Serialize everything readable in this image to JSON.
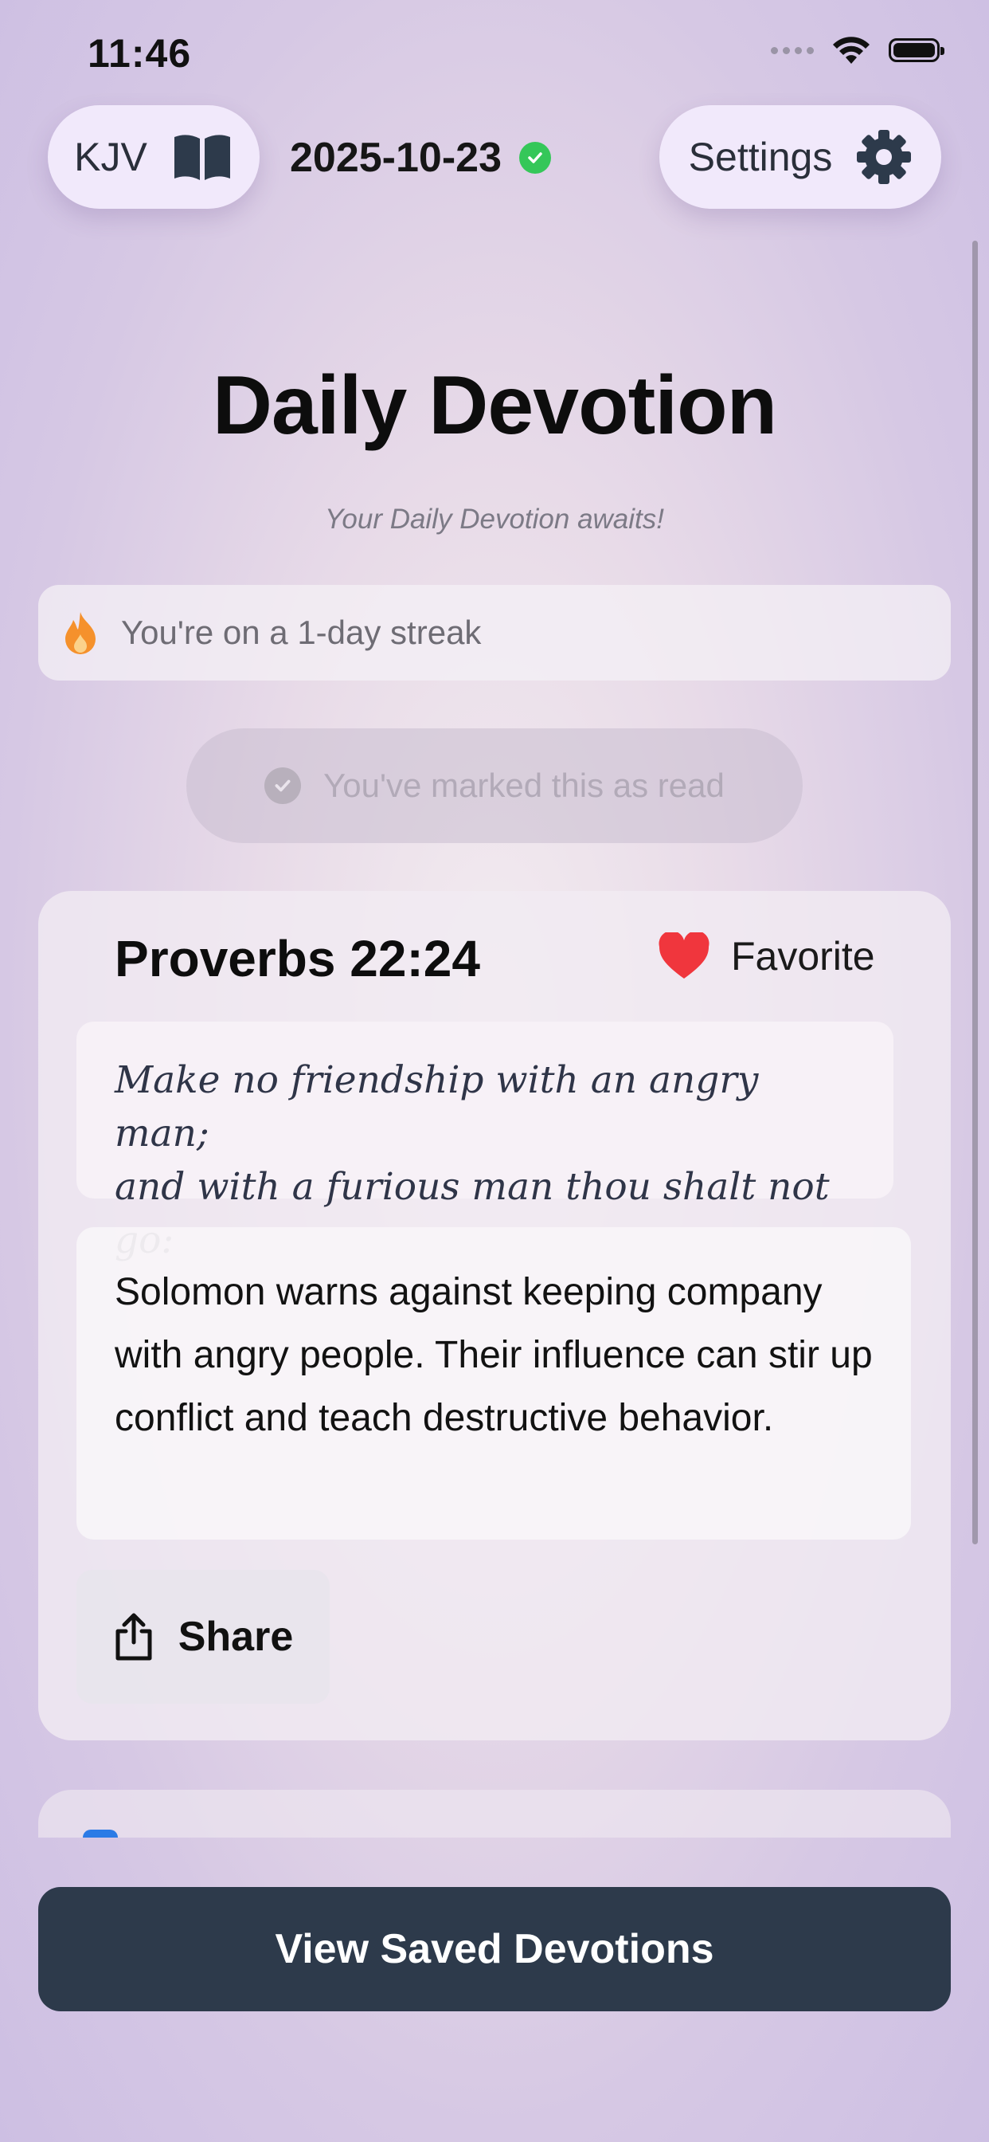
{
  "status_bar": {
    "time": "11:46"
  },
  "header": {
    "translation_label": "KJV",
    "date": "2025-10-23",
    "settings_label": "Settings"
  },
  "page": {
    "title": "Daily Devotion",
    "subtitle": "Your Daily Devotion awaits!",
    "streak_text": "You're on a 1-day streak",
    "read_status": "You've marked this as read"
  },
  "devotion": {
    "reference": "Proverbs 22:24",
    "favorite_label": "Favorite",
    "verse_line1": "Make no friendship with an angry man;",
    "verse_line2": "and with a furious man thou shalt not go:",
    "explanation": "Solomon warns against keeping company with angry people. Their influence can stir up conflict and teach destructive behavior.",
    "share_label": "Share"
  },
  "bottom": {
    "saved_button_label": "View Saved Devotions"
  },
  "colors": {
    "accent_dark": "#2d3a4b",
    "success_green": "#35c759",
    "heart_red": "#f0363d",
    "flame_orange": "#f5912c"
  }
}
